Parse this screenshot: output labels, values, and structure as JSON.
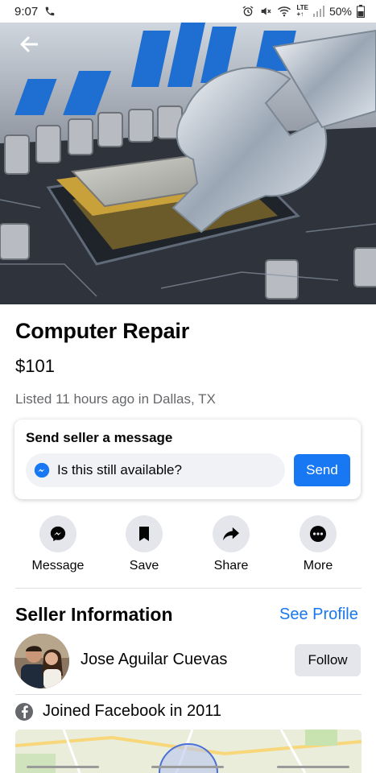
{
  "status_bar": {
    "time": "9:07",
    "battery": "50%",
    "network_top": "LTE",
    "network_bottom": "+↑",
    "icons": [
      "phone-icon",
      "alarm-icon",
      "mute-icon",
      "wifi-icon",
      "signal-icon",
      "battery-icon"
    ]
  },
  "hero": {
    "description_icon": "computer-repair-photo",
    "back_icon": "back-arrow-icon"
  },
  "listing": {
    "title": "Computer Repair",
    "price": "$101",
    "listed": "Listed 11 hours ago in Dallas, TX"
  },
  "message_card": {
    "title": "Send seller a message",
    "input_value": "Is this still available?",
    "send_label": "Send",
    "messenger_icon": "messenger-icon"
  },
  "actions": [
    {
      "label": "Message",
      "icon": "messenger-icon"
    },
    {
      "label": "Save",
      "icon": "bookmark-icon"
    },
    {
      "label": "Share",
      "icon": "share-arrow-icon"
    },
    {
      "label": "More",
      "icon": "more-dots-icon"
    }
  ],
  "seller": {
    "heading": "Seller Information",
    "see_profile": "See Profile",
    "name": "Jose Aguilar Cuevas",
    "follow_label": "Follow",
    "joined": "Joined Facebook in 2011"
  },
  "colors": {
    "accent": "#1877f2",
    "secondary_text": "#65676b",
    "button_gray": "#e4e6eb"
  }
}
